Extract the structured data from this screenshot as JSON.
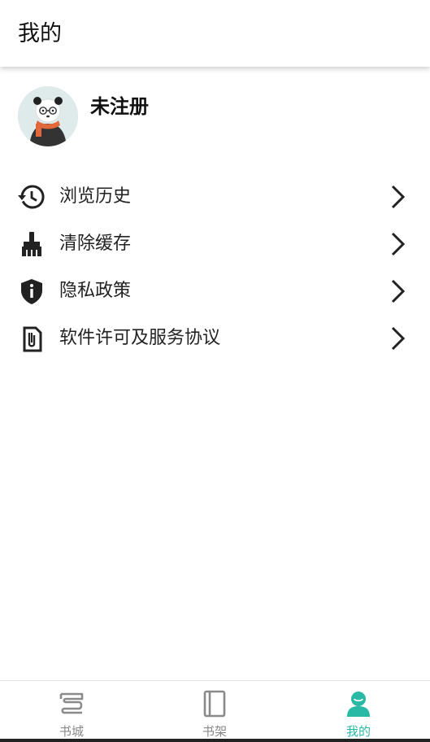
{
  "header": {
    "title": "我的"
  },
  "profile": {
    "username": "未注册",
    "avatar_icon": "panda-avatar"
  },
  "menu": [
    {
      "label": "浏览历史",
      "icon": "history-icon"
    },
    {
      "label": "清除缓存",
      "icon": "broom-icon"
    },
    {
      "label": "隐私政策",
      "icon": "shield-info-icon"
    },
    {
      "label": "软件许可及服务协议",
      "icon": "paperclip-document-icon"
    }
  ],
  "bottom_nav": [
    {
      "label": "书城",
      "icon": "bookstore-icon",
      "active": false
    },
    {
      "label": "书架",
      "icon": "bookshelf-icon",
      "active": false
    },
    {
      "label": "我的",
      "icon": "profile-icon",
      "active": true
    }
  ],
  "colors": {
    "accent": "#2ab9a4",
    "inactive": "#888888",
    "text": "#222222"
  }
}
